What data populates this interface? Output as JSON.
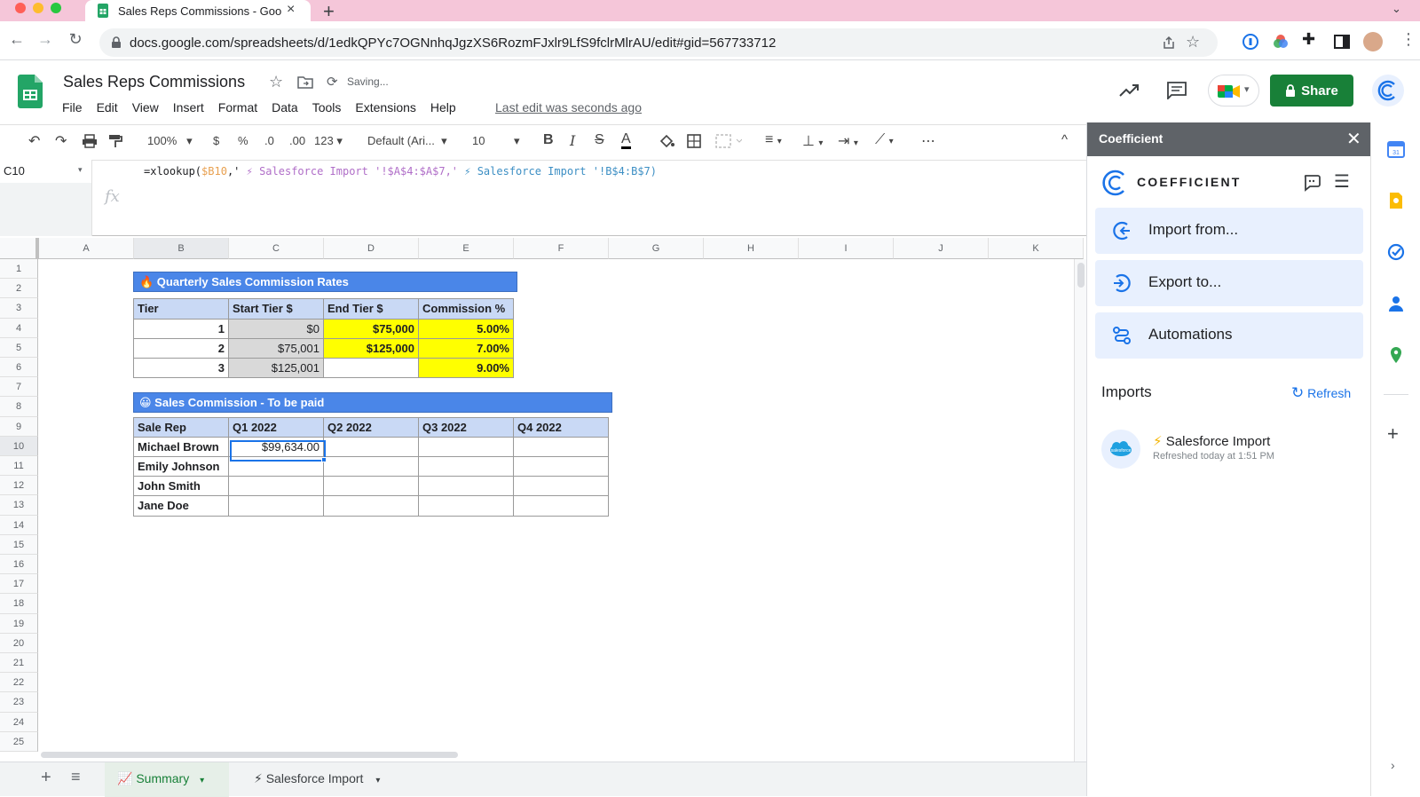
{
  "browser": {
    "tab_title": "Sales Reps Commissions - Goo",
    "url": "docs.google.com/spreadsheets/d/1edkQPYc7OGNnhqJgzXS6RozmFJxlr9LfS9fclrMlrAU/edit#gid=567733712"
  },
  "doc": {
    "title": "Sales Reps Commissions",
    "status": "Saving...",
    "last_edit": "Last edit was seconds ago",
    "share_label": "Share",
    "menu": [
      "File",
      "Edit",
      "View",
      "Insert",
      "Format",
      "Data",
      "Tools",
      "Extensions",
      "Help"
    ]
  },
  "format_toolbar": {
    "zoom": "100%",
    "currency": "$",
    "percent": "%",
    "dec_less": ".0",
    "dec_more": ".00",
    "number_format": "123",
    "font": "Default (Ari...",
    "font_size": "10",
    "more": "⋯"
  },
  "formula_bar": {
    "cell_ref": "C10",
    "fx": "fx",
    "formula_parts": [
      "=xlookup(",
      "$B10",
      ",'",
      " ⚡ Salesforce Import ",
      "'!$A$4:$A$7,'",
      " ⚡ Salesforce Import ",
      " '!B$4:B$7)"
    ]
  },
  "grid": {
    "columns": [
      "A",
      "B",
      "C",
      "D",
      "E",
      "F",
      "G",
      "H",
      "I",
      "J",
      "K"
    ],
    "rows": [
      "1",
      "2",
      "3",
      "4",
      "5",
      "6",
      "7",
      "8",
      "9",
      "10",
      "11",
      "12",
      "13",
      "14",
      "15",
      "16",
      "17",
      "18",
      "19",
      "20",
      "21",
      "22",
      "23",
      "24",
      "25"
    ]
  },
  "commission_table": {
    "banner": "🔥 Quarterly Sales Commission Rates",
    "headers": [
      "Tier",
      "Start Tier $",
      "End Tier $",
      "Commission %"
    ],
    "rows": [
      [
        "1",
        "$0",
        "$75,000",
        "5.00%"
      ],
      [
        "2",
        "$75,001",
        "$125,000",
        "7.00%"
      ],
      [
        "3",
        "$125,001",
        "",
        "9.00%"
      ]
    ]
  },
  "payout_table": {
    "banner": "😀 Sales Commission - To be paid",
    "headers": [
      "Sale Rep",
      "Q1 2022",
      "Q2 2022",
      "Q3 2022",
      "Q4 2022"
    ],
    "reps": [
      "Michael Brown",
      "Emily Johnson",
      "John Smith",
      "Jane Doe"
    ],
    "q1_michael": "$99,634.00"
  },
  "sheet_tabs": [
    {
      "label": "📈 Summary"
    },
    {
      "label": "⚡ Salesforce Import"
    }
  ],
  "coefficient": {
    "panel_title": "Coefficient",
    "brand": "COEFFICIENT",
    "buttons": [
      "Import from...",
      "Export to...",
      "Automations"
    ],
    "imports_heading": "Imports",
    "refresh_label": "Refresh",
    "import_item": {
      "name": "Salesforce Import",
      "bolt": "⚡",
      "subtitle": "Refreshed today at 1:51 PM"
    }
  },
  "colors": {
    "banner_blue": "#4a86e8",
    "header_lightblue": "#c9d9f5",
    "highlight_yellow": "#ffff00",
    "share_green": "#188038",
    "tab_pink": "#f5c6d9"
  }
}
